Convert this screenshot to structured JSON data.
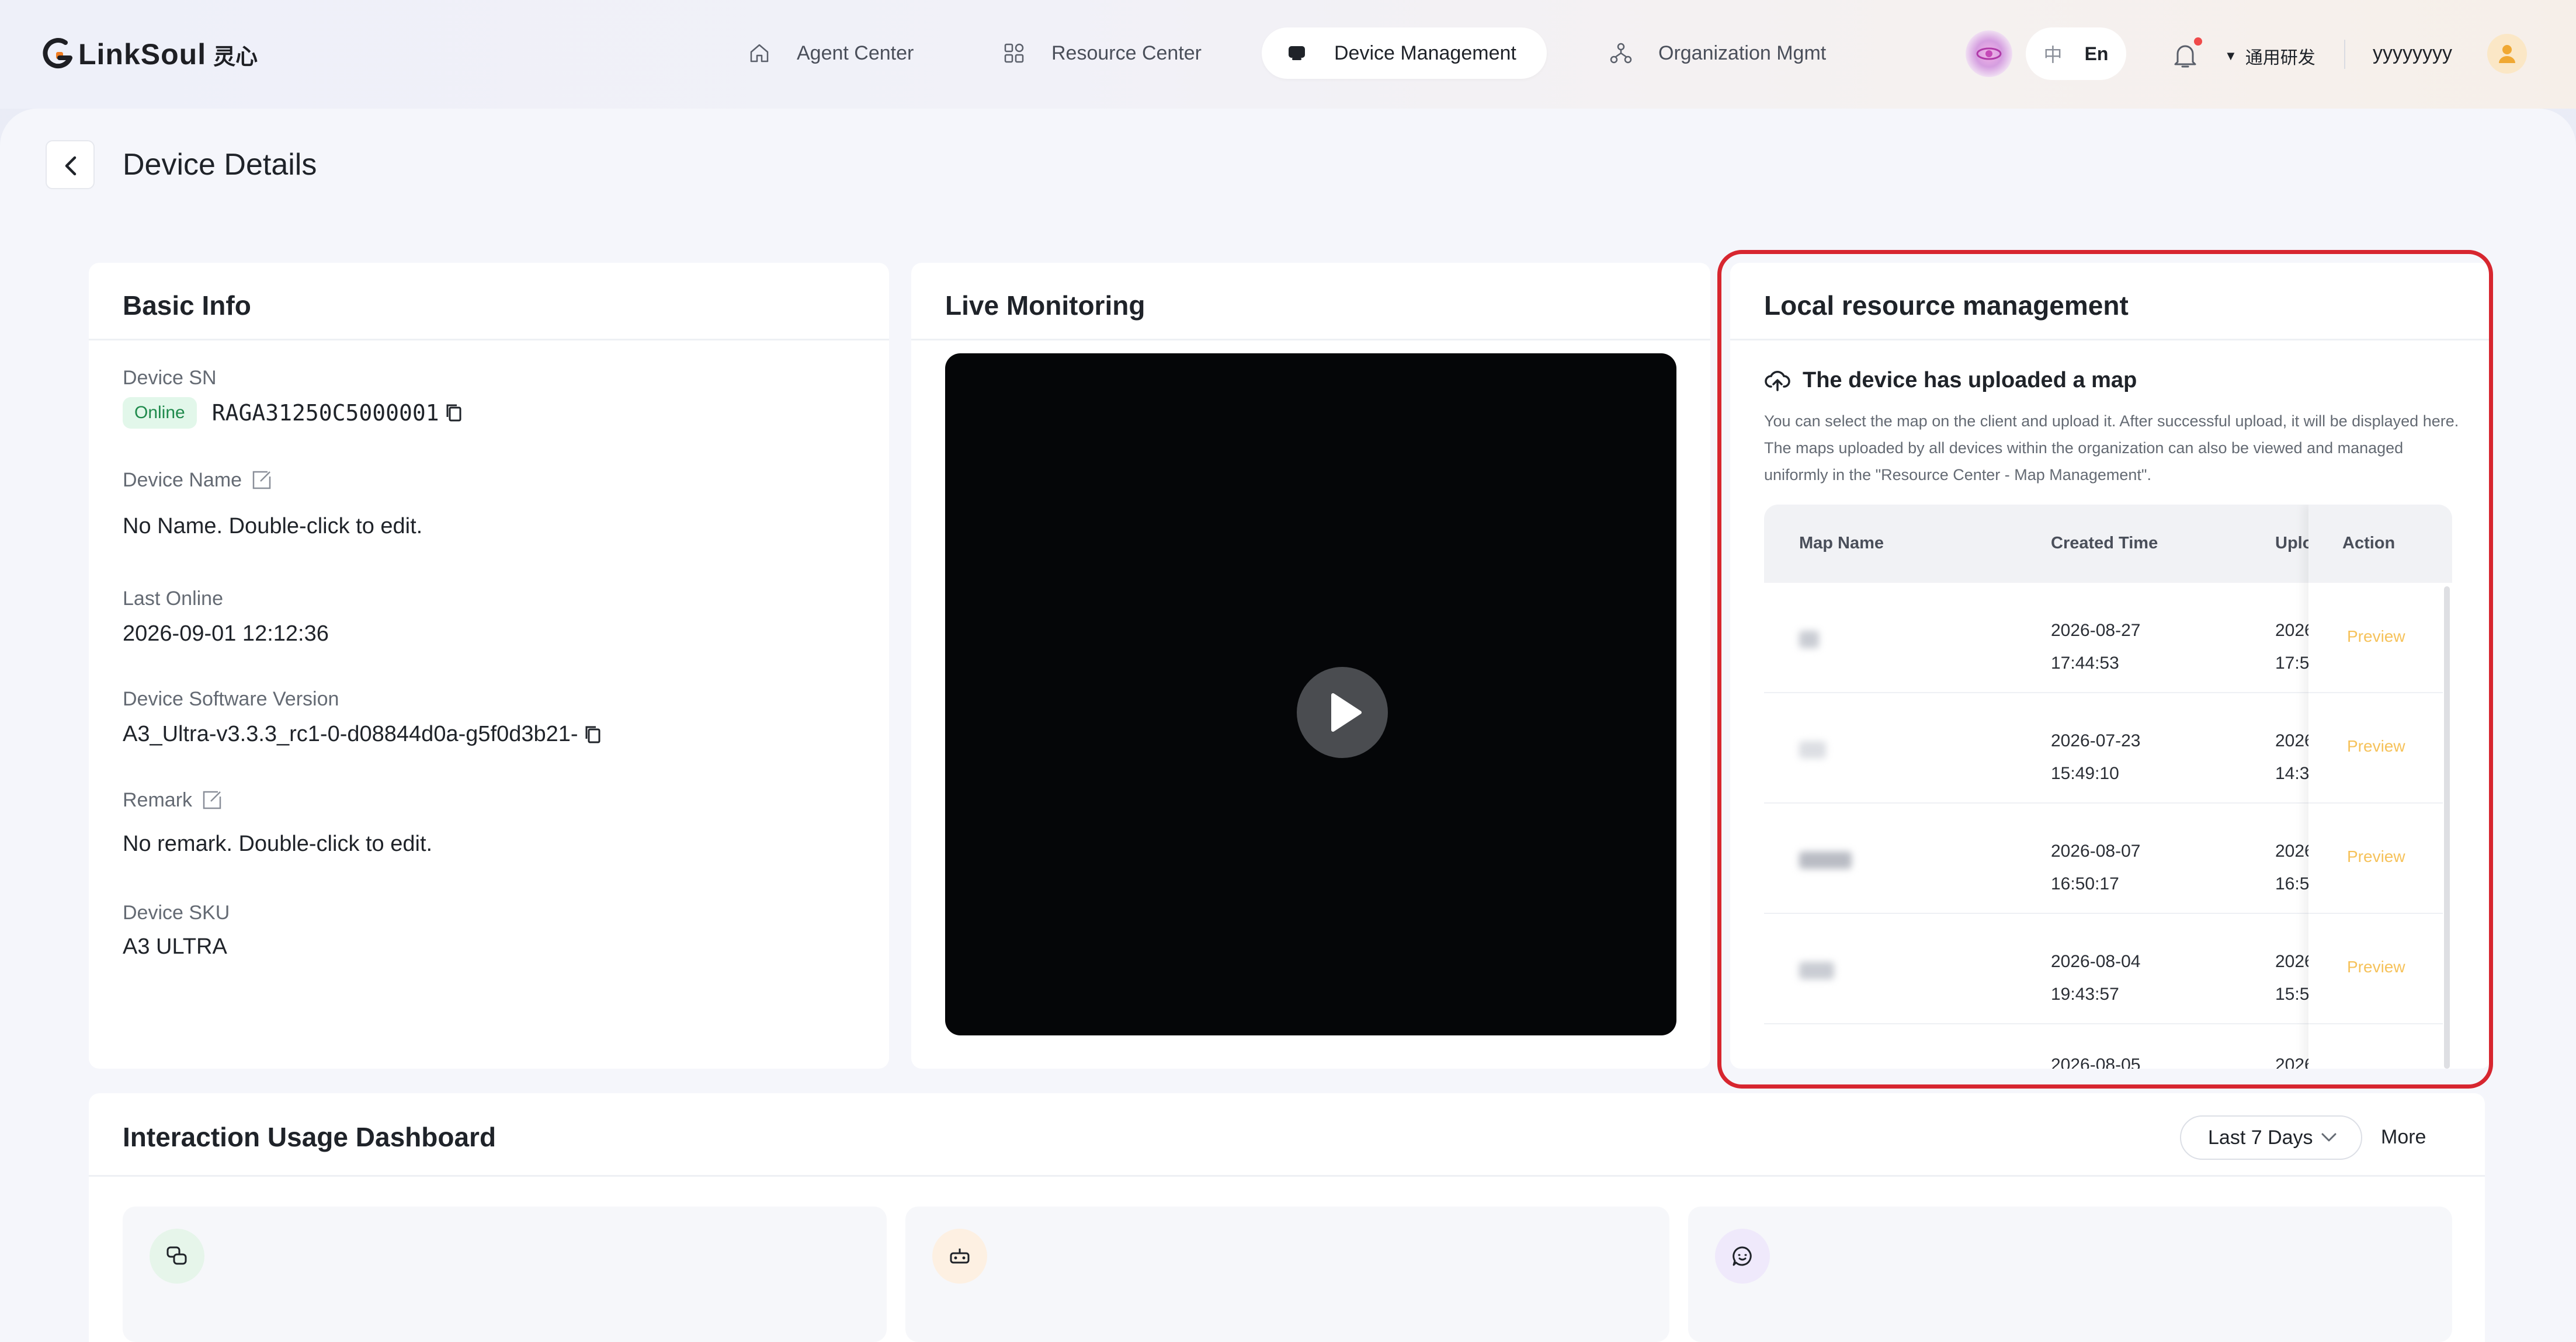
{
  "app": {
    "logo_text": "LinkSoul",
    "logo_cn": "灵心"
  },
  "nav": {
    "items": [
      {
        "label": "Agent Center",
        "icon": "home-icon"
      },
      {
        "label": "Resource Center",
        "icon": "grid-icon"
      },
      {
        "label": "Device Management",
        "icon": "device-icon",
        "active": true
      },
      {
        "label": "Organization Mgmt",
        "icon": "org-tree-icon"
      }
    ]
  },
  "header": {
    "lang_zh": "中",
    "lang_en": "En",
    "org_name": "通用研发",
    "username": "yyyyyyyy",
    "notification_dot_color": "#f04a4a"
  },
  "page": {
    "title": "Device Details"
  },
  "basic_info": {
    "title": "Basic Info",
    "sn_label": "Device SN",
    "status": "Online",
    "sn_value": "RAGA31250C5000001",
    "name_label": "Device Name",
    "name_value": "No Name. Double-click to edit.",
    "last_online_label": "Last Online",
    "last_online_value": "2026-09-01 12:12:36",
    "software_label": "Device Software Version",
    "software_value": "A3_Ultra-v3.3.3_rc1-0-d08844d0a-g5f0d3b21-",
    "remark_label": "Remark",
    "remark_value": "No remark. Double-click to edit.",
    "sku_label": "Device SKU",
    "sku_value": "A3 ULTRA"
  },
  "live": {
    "title": "Live Monitoring"
  },
  "local_resource": {
    "title": "Local resource management",
    "upload_heading": "The device has uploaded a map",
    "upload_description": "You can select the map on the client and upload it. After successful upload, it will be displayed here. The maps uploaded by all devices within the organization can also be viewed and managed uniformly in the \"Resource Center - Map Management\".",
    "columns": {
      "map_name": "Map Name",
      "created_time": "Created Time",
      "uploaded_time": "Uplo",
      "action": "Action"
    },
    "action_label": "Preview",
    "rows": [
      {
        "created_date": "2026-08-27",
        "created_time": "17:44:53",
        "upd_date": "2026",
        "upd_time": "17:5"
      },
      {
        "created_date": "2026-07-23",
        "created_time": "15:49:10",
        "upd_date": "2026",
        "upd_time": "14:3"
      },
      {
        "created_date": "2026-08-07",
        "created_time": "16:50:17",
        "upd_date": "2026",
        "upd_time": "16:5"
      },
      {
        "created_date": "2026-08-04",
        "created_time": "19:43:57",
        "upd_date": "2026",
        "upd_time": "15:5"
      },
      {
        "created_date": "2026-08-05",
        "created_time": "",
        "upd_date": "2026",
        "upd_time": ""
      }
    ],
    "highlight_color": "#d7262f",
    "preview_color": "#f6c25a"
  },
  "dashboard": {
    "title": "Interaction Usage Dashboard",
    "range_label": "Last 7 Days",
    "more_label": "More",
    "metrics": [
      {
        "icon": "chat-bubbles-icon",
        "color": "#e6f5ea"
      },
      {
        "icon": "robot-device-icon",
        "color": "#fdf0e2"
      },
      {
        "icon": "message-icon",
        "color": "#efe9fb"
      }
    ]
  }
}
